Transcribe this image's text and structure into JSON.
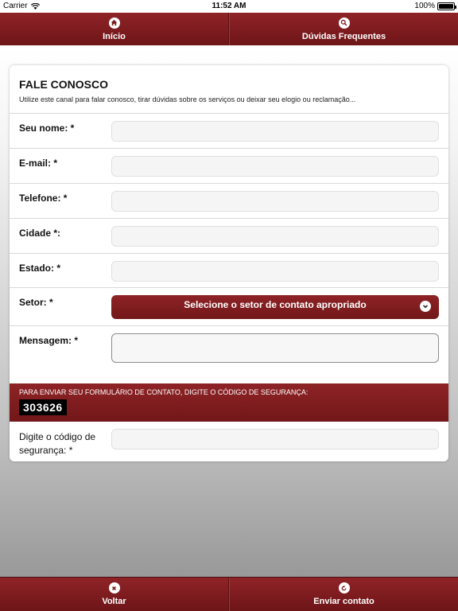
{
  "status_bar": {
    "carrier": "Carrier",
    "time": "11:52 AM",
    "battery": "100%",
    "battery_level": 1.0
  },
  "nav_top": {
    "home_label": "Início",
    "home_icon": "home-icon",
    "faq_label": "Dúvidas Frequentes",
    "faq_icon": "search-icon"
  },
  "form": {
    "title": "FALE CONOSCO",
    "subtitle": "Utilize este canal para falar conosco, tirar dúvidas sobre os serviços ou deixar seu elogio ou reclamação...",
    "fields": {
      "name_label": "Seu nome: *",
      "name_value": "",
      "email_label": "E-mail: *",
      "email_value": "",
      "phone_label": "Telefone: *",
      "phone_value": "",
      "city_label": "Cidade *:",
      "city_value": "",
      "state_label": "Estado: *",
      "state_value": "",
      "sector_label": "Setor: *",
      "sector_selected": "Selecione o setor de contato apropriado",
      "message_label": "Mensagem: *",
      "message_value": ""
    },
    "security": {
      "instruction": "PARA ENVIAR SEU FORMULÁRIO DE CONTATO, DIGITE O CÓDIGO DE SEGURANÇA:",
      "code": "303626",
      "input_label": "Digite o código de segurança: *",
      "input_value": ""
    }
  },
  "nav_bottom": {
    "back_label": "Voltar",
    "back_icon": "close-icon",
    "send_label": "Enviar contato",
    "send_icon": "refresh-icon"
  },
  "colors": {
    "brand": "#8f2327",
    "brand_dark": "#6e1518"
  }
}
